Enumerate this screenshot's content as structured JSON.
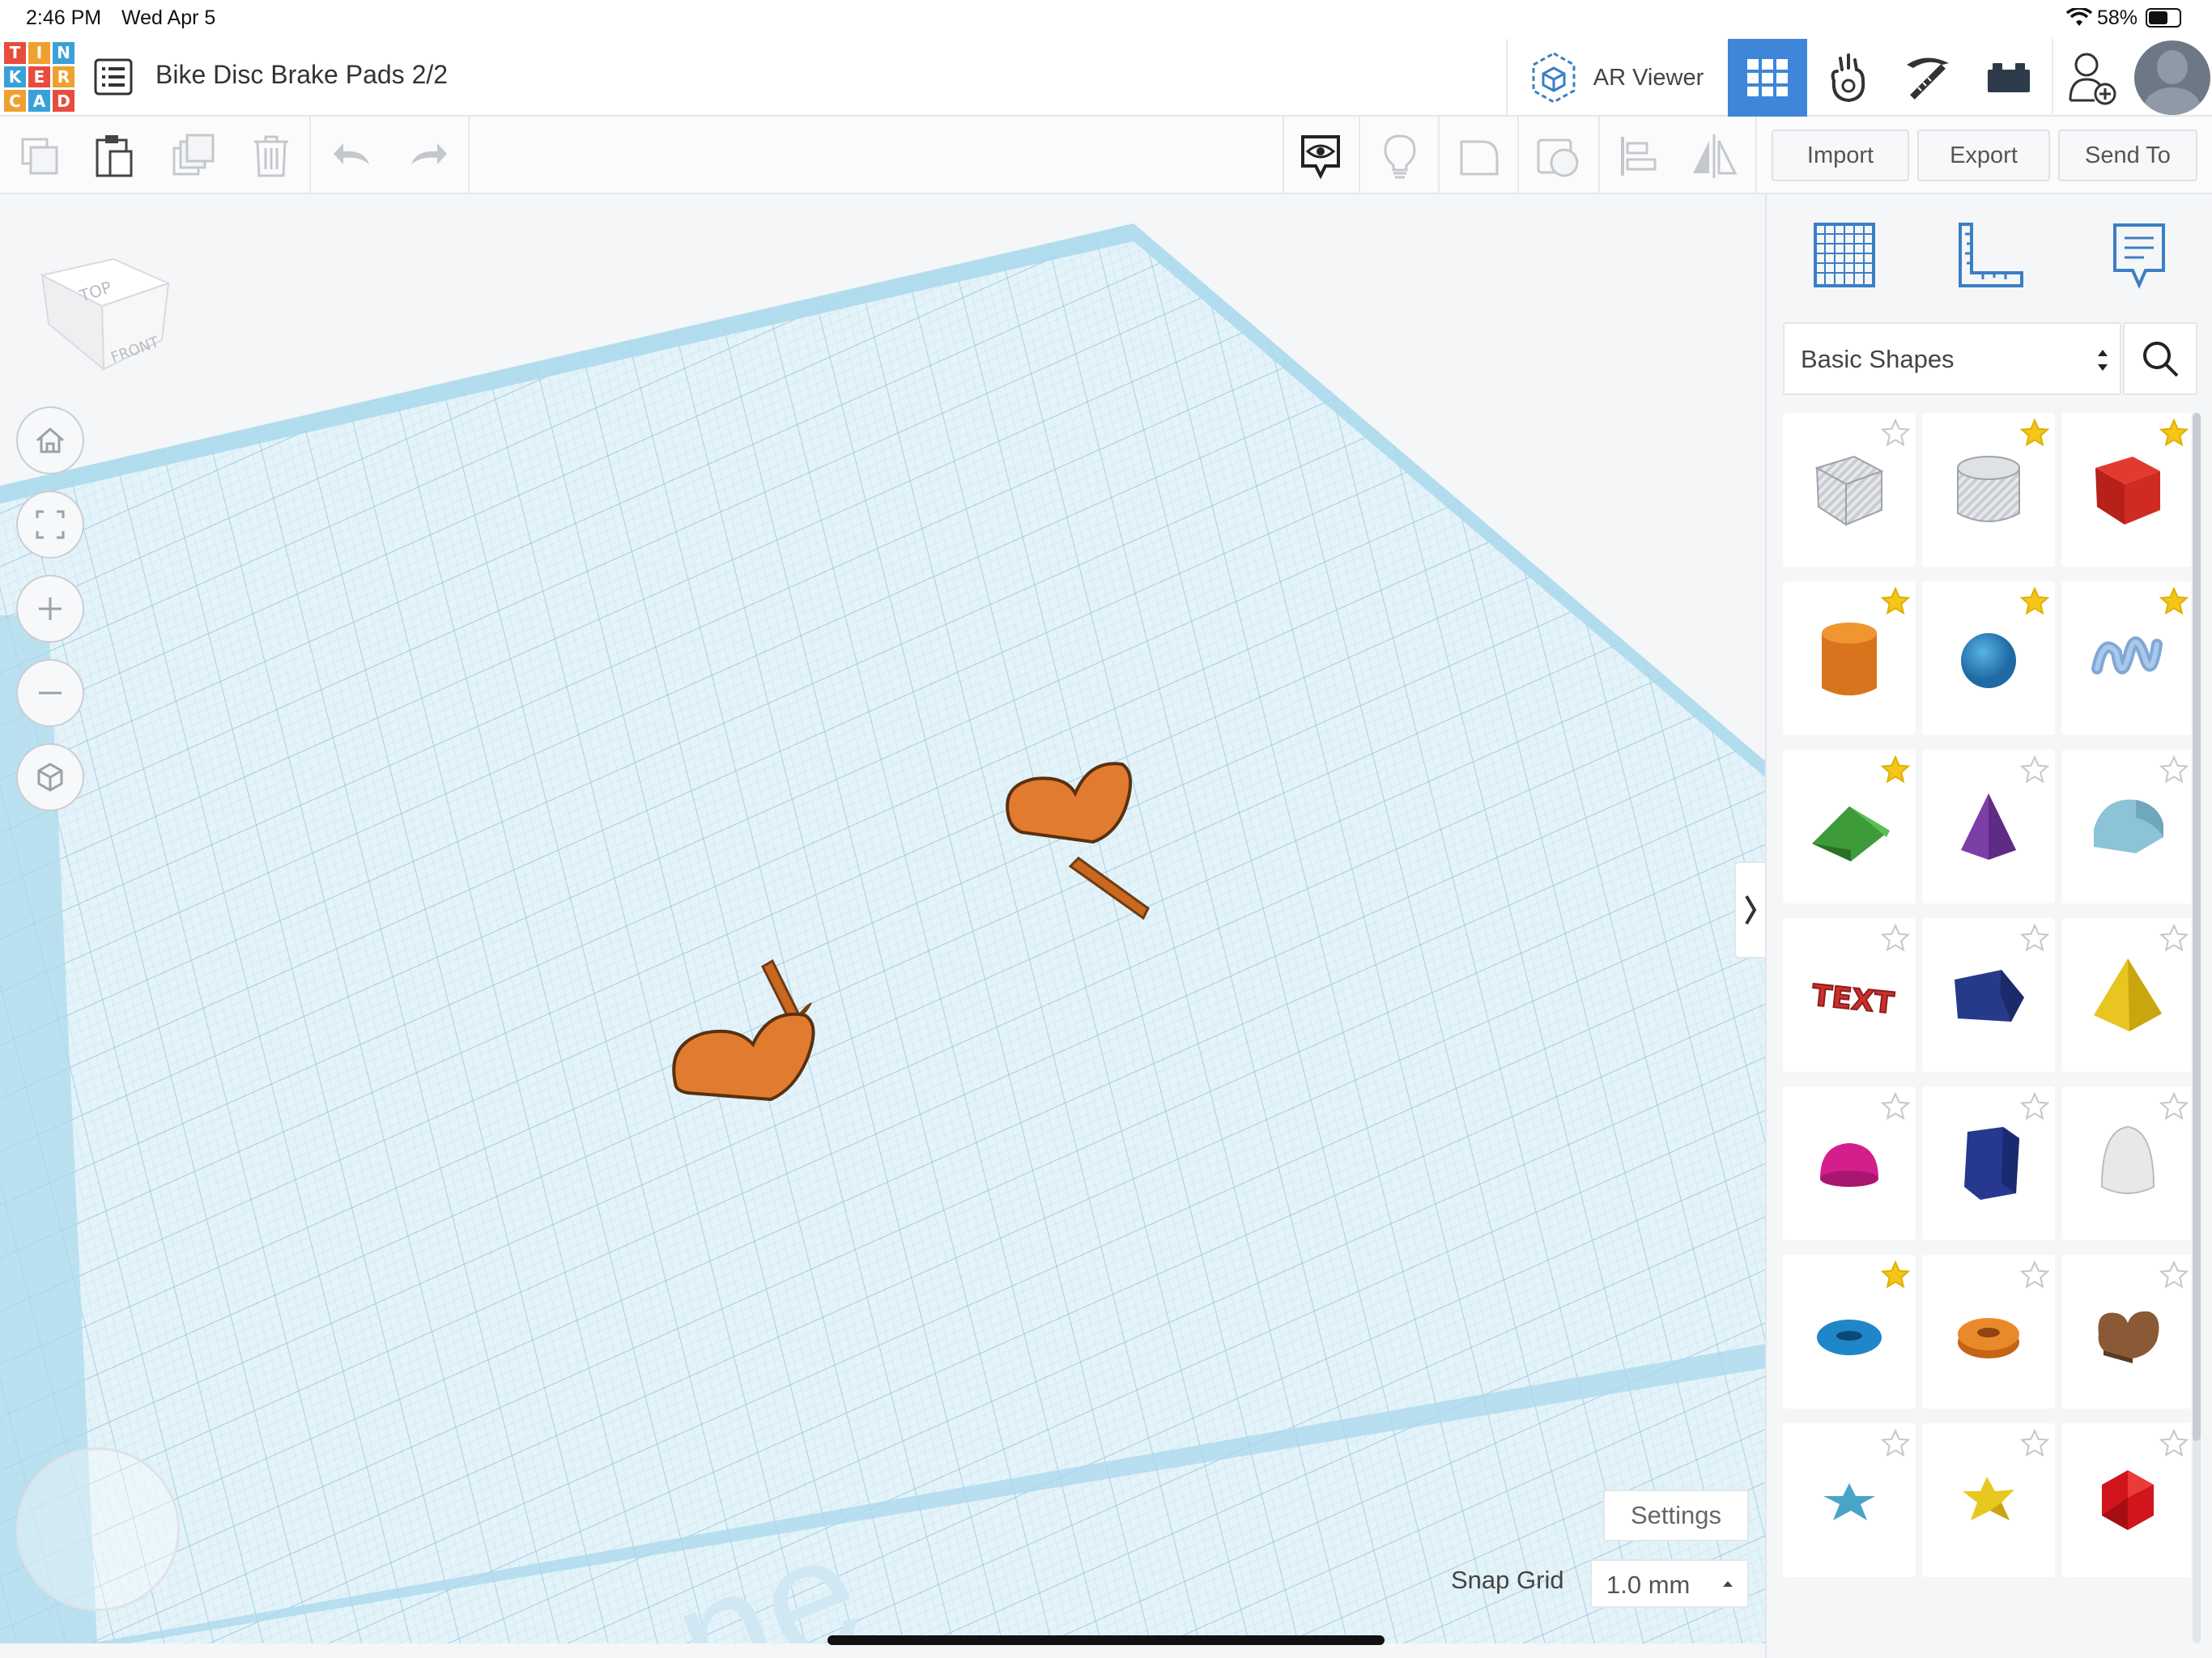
{
  "status_bar": {
    "time": "2:46 PM",
    "date": "Wed Apr 5",
    "battery": "58%"
  },
  "logo": {
    "letters": [
      "T",
      "I",
      "N",
      "K",
      "E",
      "R",
      "C",
      "A",
      "D"
    ],
    "colors": [
      "#e74c3c",
      "#f0a030",
      "#3aa0d8",
      "#3aa0d8",
      "#e74c3c",
      "#f0a030",
      "#f0a030",
      "#3aa0d8",
      "#e74c3c"
    ]
  },
  "header": {
    "design_title": "Bike Disc Brake Pads 2/2",
    "ar_viewer_label": "AR Viewer",
    "icons": [
      "list-icon",
      "ar-viewer-icon",
      "grid-view-icon",
      "tinker-hand-icon",
      "pickaxe-icon",
      "bricks-icon",
      "add-user-icon",
      "avatar"
    ]
  },
  "toolbar": {
    "import_label": "Import",
    "export_label": "Export",
    "send_to_label": "Send To",
    "icons": [
      "copy-icon",
      "paste-icon",
      "duplicate-icon",
      "delete-icon",
      "undo-icon",
      "redo-icon",
      "notes-eye-icon",
      "light-bulb-icon",
      "shape-icon",
      "hole-icon",
      "align-icon",
      "mirror-icon"
    ]
  },
  "viewcube": {
    "top": "TOP",
    "front": "FRONT"
  },
  "workplane": {
    "settings_label": "Settings",
    "snap_grid_label": "Snap Grid",
    "snap_grid_value": "1.0 mm",
    "watermark": "ne",
    "accent": "#a9d8ec",
    "object_color": "#e07b30"
  },
  "panel": {
    "tabs": [
      "workplane-grid-icon",
      "ruler-icon",
      "notes-icon"
    ],
    "category": "Basic Shapes",
    "expand_icon": "chevron-right-icon",
    "shapes": [
      {
        "name": "box-hole",
        "starred": false
      },
      {
        "name": "cylinder-hole",
        "starred": true
      },
      {
        "name": "box",
        "starred": true
      },
      {
        "name": "cylinder",
        "starred": true
      },
      {
        "name": "sphere",
        "starred": true
      },
      {
        "name": "scribble",
        "starred": true
      },
      {
        "name": "roof",
        "starred": true
      },
      {
        "name": "cone",
        "starred": false
      },
      {
        "name": "round-roof",
        "starred": false
      },
      {
        "name": "text",
        "starred": false
      },
      {
        "name": "wedge",
        "starred": false
      },
      {
        "name": "pyramid",
        "starred": false
      },
      {
        "name": "half-sphere",
        "starred": false
      },
      {
        "name": "polygon",
        "starred": false
      },
      {
        "name": "paraboloid",
        "starred": false
      },
      {
        "name": "torus",
        "starred": true
      },
      {
        "name": "tube",
        "starred": false
      },
      {
        "name": "heart",
        "starred": false
      },
      {
        "name": "star",
        "starred": false
      },
      {
        "name": "star-yellow",
        "starred": false
      },
      {
        "name": "icosahedron",
        "starred": false
      }
    ]
  }
}
